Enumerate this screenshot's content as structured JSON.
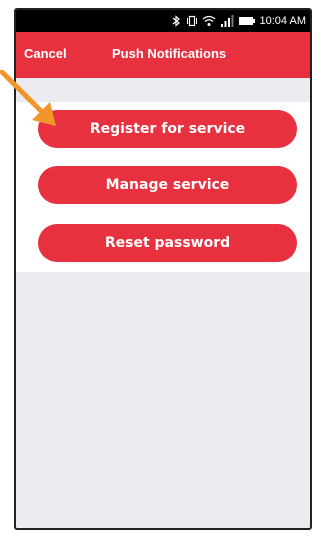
{
  "status_bar": {
    "time": "10:04 AM",
    "icons": [
      "bluetooth-icon",
      "vibrate-icon",
      "wifi-icon",
      "signal-icon",
      "battery-icon"
    ]
  },
  "header": {
    "cancel_label": "Cancel",
    "title": "Push Notifications",
    "color": "#e8313f"
  },
  "buttons": [
    {
      "label": "Register for service"
    },
    {
      "label": "Manage service"
    },
    {
      "label": "Reset password"
    }
  ],
  "colors": {
    "accent": "#e8313f",
    "background": "#ecebef",
    "annotation_arrow": "#f0962b"
  }
}
